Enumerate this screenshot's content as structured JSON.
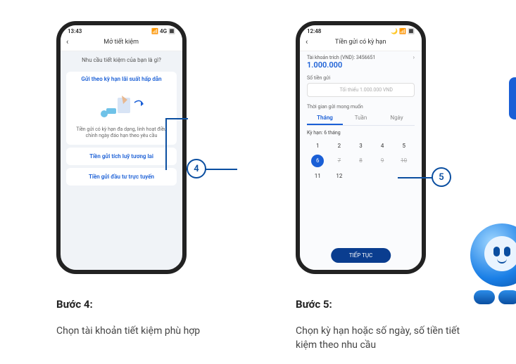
{
  "step4": {
    "label": "Bước 4:",
    "desc": "Chọn tài khoản tiết kiệm phù hợp",
    "indicator": "4",
    "screen": {
      "time": "13:43",
      "signal": "📶 4G 🔳",
      "header_title": "Mở tiết kiệm",
      "subtitle": "Nhu cầu tiết kiệm của bạn là gì?",
      "card1_title": "Gửi theo kỳ hạn lãi suất hấp dẫn",
      "card1_desc": "Tiền gửi có kỳ hạn đa dạng, linh hoạt điều chỉnh ngày đáo hạn theo yêu cầu",
      "card2_title": "Tiền gửi tích luỹ tương lai",
      "card3_title": "Tiền gửi đầu tư trực tuyến"
    }
  },
  "step5": {
    "label": "Bước 5:",
    "desc": "Chọn kỳ hạn hoặc số ngày, số tiền tiết kiệm theo nhu cầu",
    "indicator": "5",
    "screen": {
      "time": "12:48",
      "signal": "🌙 📶 🔳",
      "header_title": "Tiền gửi có kỳ hạn",
      "account_label": "Tài khoản trích (VND): 3456651",
      "balance": "1.000.000",
      "amount_label": "Số tiền gửi",
      "amount_placeholder": "Tối thiểu 1.000.000 VND",
      "period_label": "Thời gian gửi mong muốn",
      "tab_month": "Tháng",
      "tab_week": "Tuần",
      "tab_day": "Ngày",
      "term_label": "Kỳ hạn: 6 tháng",
      "grid": [
        "1",
        "2",
        "3",
        "4",
        "5",
        "6",
        "7",
        "8",
        "9",
        "10",
        "11",
        "12"
      ],
      "selected_index": 5,
      "struck_indices": [
        6,
        7,
        8,
        9
      ],
      "cta": "TIẾP TỤC"
    }
  }
}
